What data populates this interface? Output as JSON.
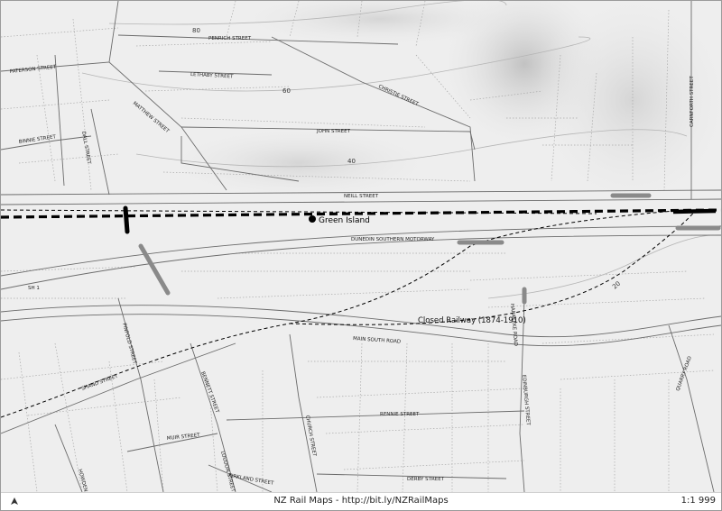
{
  "map": {
    "streets": {
      "penrich": "PENRICH STREET",
      "paterson": "PATERSON STREET",
      "lethaby": "LETHABY STREET",
      "christie": "CHRISTIE STREET",
      "matthew": "MATTHEW STREET",
      "john": "JOHN STREET",
      "binnie": "BINNIE STREET",
      "dall": "DALL STREET",
      "carnforth": "CARNFORTH STREET",
      "neill": "NEILL STREET",
      "motorway": "DUNEDIN SOUTHERN MOTORWAY",
      "sh1": "SH 1",
      "main_south": "MAIN SOUTH ROAD",
      "pinfold": "PINFOLD STREET",
      "harakeke": "HARAKEKE ROAD",
      "edinburgh": "EDINBURGH STREET",
      "quarry": "QUARRY ROAD",
      "shand": "SHAND STREET",
      "bennett": "BENNETT STREET",
      "church": "CHURCH STREET",
      "rennie": "RENNIE STREET",
      "muir": "MUIR STREET",
      "loudon": "LOUDON STREET",
      "kirkland": "KIRKLAND STREET",
      "derby": "DERBY STREET",
      "howden": "HOWDEN"
    },
    "contours": {
      "c80": "80",
      "c60": "60",
      "c40": "40",
      "c20": "20"
    },
    "station": "Green Island",
    "closed_railway": "Closed Railway (1874-1910)",
    "colors": {
      "active_rail": "#000000",
      "closed_rail": "#000000",
      "road": "#6b6b6b",
      "bridge": "#8a8a8a",
      "land": "#efefef",
      "relief": "#c4c4c4"
    }
  },
  "footer": {
    "attribution": "NZ Rail Maps - http://bit.ly/NZRailMaps",
    "scale": "1:1 999",
    "icon": "north-arrow-icon"
  }
}
